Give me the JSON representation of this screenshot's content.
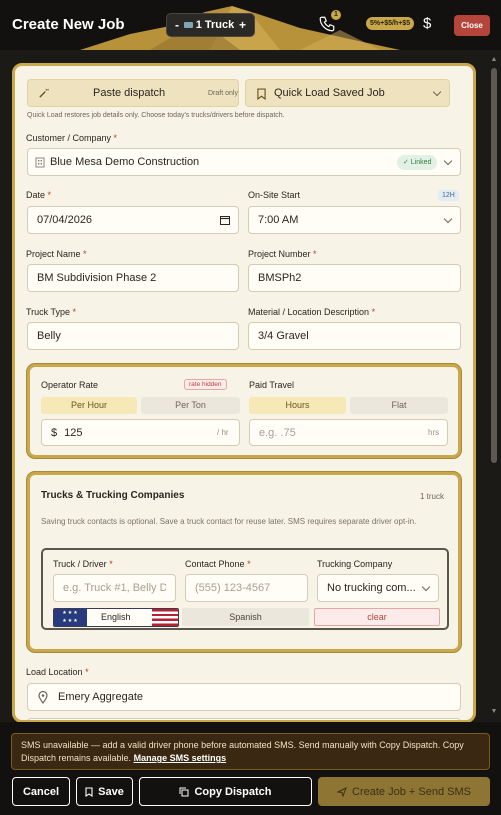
{
  "header": {
    "title": "Create New Job",
    "truck_count_label": "1 Truck",
    "decrement": "-",
    "increment": "+",
    "notification_count": "1",
    "fee_badge": "5%+$5/h+$5",
    "dollar": "$",
    "close_label": "Close"
  },
  "quick_actions": {
    "paste_label": "Paste dispatch",
    "draft_label": "Draft only",
    "saved_job_label": "Quick Load Saved Job",
    "hint": "Quick Load restores job details only. Choose today's trucks/drivers before dispatch."
  },
  "customer": {
    "label": "Customer / Company",
    "required": "*",
    "value": "Blue Mesa Demo Construction",
    "linked_badge": "✓ Linked"
  },
  "date": {
    "label": "Date",
    "required": "*",
    "value": "07/04/2026"
  },
  "onsite": {
    "label": "On-Site Start",
    "format_badge": "12H",
    "value": "7:00 AM"
  },
  "project_name": {
    "label": "Project Name",
    "required": "*",
    "value": "BM Subdivision Phase 2"
  },
  "project_number": {
    "label": "Project Number",
    "required": "*",
    "value": "BMSPh2"
  },
  "truck_type": {
    "label": "Truck Type",
    "required": "*",
    "value": "Belly"
  },
  "material": {
    "label": "Material / Location Description",
    "required": "*",
    "value": "3/4 Gravel"
  },
  "rates": {
    "operator_label": "Operator Rate",
    "rate_hidden_badge": "rate hidden",
    "per_hour": "Per Hour",
    "per_ton": "Per Ton",
    "currency": "$",
    "operator_value": "125",
    "operator_unit": "/ hr",
    "travel_label": "Paid Travel",
    "hours": "Hours",
    "flat": "Flat",
    "travel_placeholder": "e.g. .75",
    "travel_unit": "hrs"
  },
  "trucks": {
    "title": "Trucks & Trucking Companies",
    "count": "1 truck",
    "note": "Saving truck contacts is optional. Save a truck contact for reuse later. SMS requires separate driver opt-in.",
    "driver_label": "Truck / Driver",
    "driver_placeholder": "e.g. Truck #1, Belly Dump",
    "phone_label": "Contact Phone",
    "phone_placeholder": "(555) 123-4567",
    "company_label": "Trucking Company",
    "company_value": "No trucking com...",
    "required": "*",
    "english": "English",
    "spanish": "Spanish",
    "clear": "clear"
  },
  "load_location": {
    "label": "Load Location",
    "required": "*",
    "value": "Emery Aggregate"
  },
  "footer": {
    "sms_warning": "SMS unavailable — add a valid driver phone before automated SMS. Send manually with Copy Dispatch. Copy Dispatch remains available.",
    "sms_link": "Manage SMS settings",
    "cancel": "Cancel",
    "save": "Save",
    "copy": "Copy Dispatch",
    "create": "Create Job + Send SMS"
  },
  "colors": {
    "accent_gold": "#c9a84b",
    "danger": "#b5453b",
    "panel_bg": "#f7f3e6",
    "header_bg": "#121110"
  }
}
